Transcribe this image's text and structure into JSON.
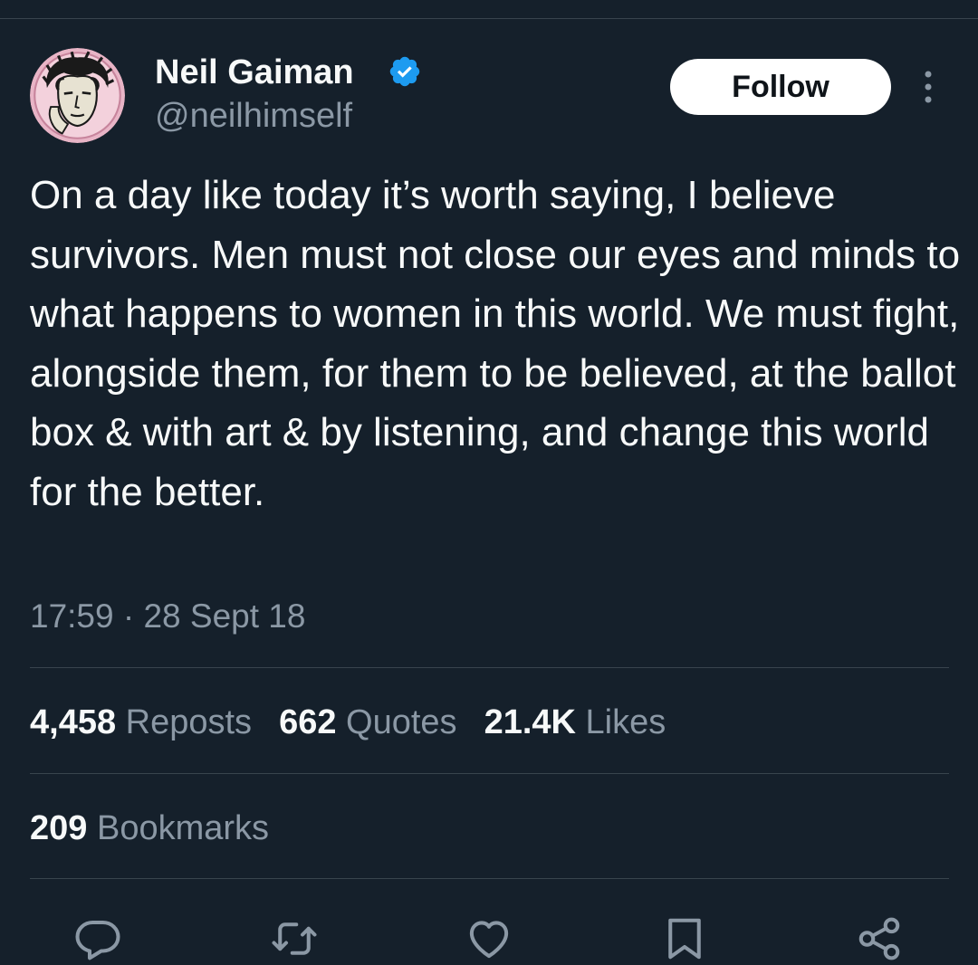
{
  "author": {
    "display_name": "Neil Gaiman",
    "handle": "@neilhimself",
    "verified": true,
    "avatar_icon": "avatar-illustration"
  },
  "header": {
    "follow_label": "Follow",
    "more_icon": "more-vertical-icon"
  },
  "tweet": {
    "text": "On a day like today it’s worth saying, I believe survivors. Men must not close our eyes and minds to what happens to women in this world. We must fight, alongside them, for them to be believed, at the ballot box & with art & by listening, and change this world for the better.",
    "timestamp": "17:59 · 28 Sept 18"
  },
  "stats": {
    "reposts": {
      "count": "4,458",
      "label": "Reposts"
    },
    "quotes": {
      "count": "662",
      "label": "Quotes"
    },
    "likes": {
      "count": "21.4K",
      "label": "Likes"
    },
    "bookmarks": {
      "count": "209",
      "label": "Bookmarks"
    }
  },
  "actions": [
    "reply-icon",
    "repost-icon",
    "like-icon",
    "bookmark-icon",
    "share-icon"
  ],
  "colors": {
    "background": "#15202b",
    "text_primary": "#f7f9f9",
    "text_secondary": "#8b98a5",
    "divider": "#38444d",
    "verified": "#1d9bf0",
    "follow_button_bg": "#ffffff",
    "follow_button_text": "#0f1419"
  }
}
